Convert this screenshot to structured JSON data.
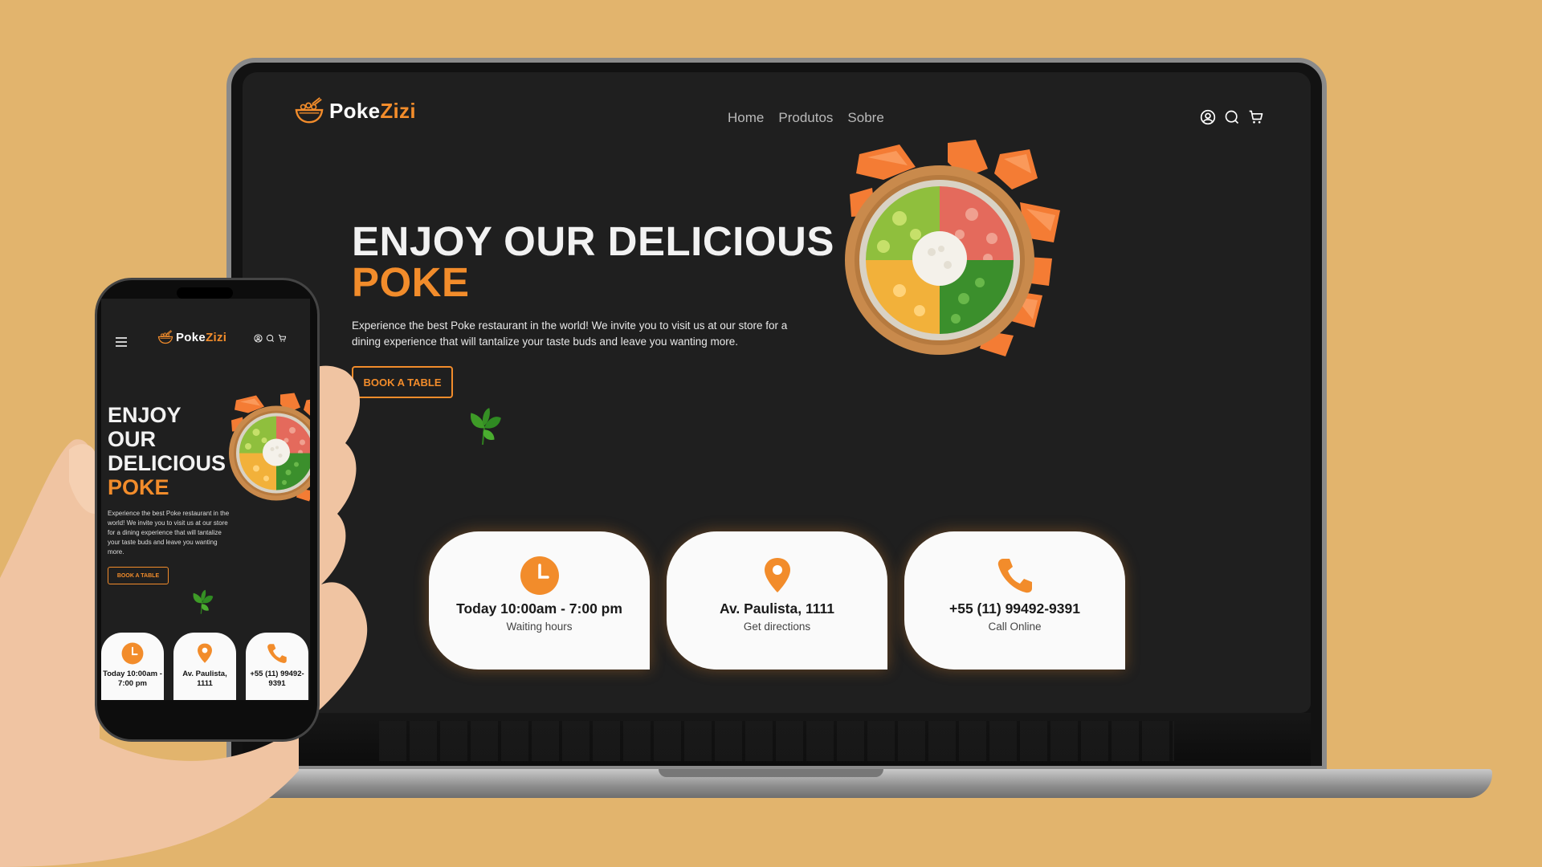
{
  "brand": {
    "name_main": "Poke",
    "name_accent": "Zizi"
  },
  "nav": {
    "items": [
      "Home",
      "Produtos",
      "Sobre"
    ]
  },
  "header_icons": [
    "user-icon",
    "search-icon",
    "cart-icon"
  ],
  "hero": {
    "title_line1": "ENJOY OUR DELICIOUS",
    "title_accent": "POKE",
    "description": "Experience the best Poke restaurant in the world! We invite you to visit us at our store for a dining experience that will tantalize your taste buds and leave you wanting more.",
    "cta_label": "BOOK A TABLE"
  },
  "info_cards": [
    {
      "icon": "clock-icon",
      "title": "Today 10:00am - 7:00 pm",
      "subtitle": "Waiting hours"
    },
    {
      "icon": "location-pin-icon",
      "title": "Av. Paulista, 1111",
      "subtitle": "Get directions"
    },
    {
      "icon": "phone-icon",
      "title": "+55 (11) 99492-9391",
      "subtitle": "Call Online"
    }
  ],
  "mobile": {
    "title_lines": [
      "ENJOY",
      "OUR",
      "DELICIOUS"
    ],
    "title_accent": "POKE",
    "description": "Experience the best Poke restaurant in the world! We invite you to visit us at our store for a dining experience that will tantalize your taste buds and leave you wanting more.",
    "cta_label": "BOOK A TABLE",
    "cards": [
      "Today 10:00am - 7:00 pm",
      "Av. Paulista, 1111",
      "+55 (11) 99492-9391"
    ]
  },
  "colors": {
    "accent": "#f28c2b",
    "background": "#e2b46d",
    "screen": "#1f1f1f",
    "card": "#fafafa"
  }
}
